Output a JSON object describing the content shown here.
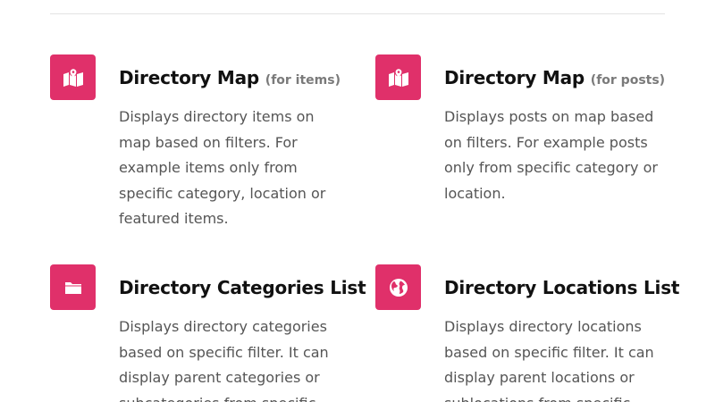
{
  "features": [
    {
      "icon": "map-icon",
      "title": "Directory Map",
      "note": "(for items)",
      "description": "Displays directory items on map based on filters. For example items only from specific category, location or featured items."
    },
    {
      "icon": "map-icon",
      "title": "Directory Map",
      "note": "(for posts)",
      "description": "Displays posts on map based on filters. For example posts only from specific category or location."
    },
    {
      "icon": "folder-icon",
      "title": "Directory Categories List",
      "note": "",
      "description": "Displays directory categories based on specific filter. It can display parent categories or subcategories from specific"
    },
    {
      "icon": "globe-icon",
      "title": "Directory Locations List",
      "note": "",
      "description": "Displays directory locations based on specific filter. It can display parent locations or sublocations from specific"
    }
  ],
  "colors": {
    "accent": "#e0306a",
    "title": "#111111",
    "note": "#7a7a7a",
    "text": "#555555",
    "divider": "#e3e3e3"
  }
}
